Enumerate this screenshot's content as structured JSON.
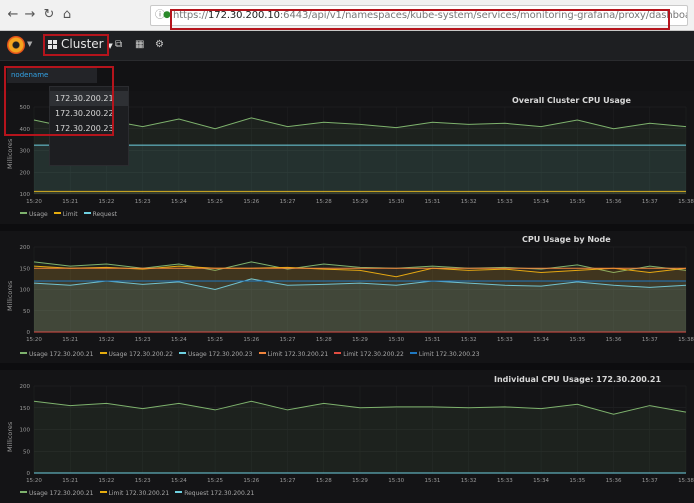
{
  "browser": {
    "url_prefix": "https://",
    "url_host": "172.30.200.10",
    "url_rest": ":6443/api/v1/namespaces/kube-system/services/monitoring-grafana/proxy/dashboard/db/cluster?orgId"
  },
  "navbar": {
    "dashboard_title": "Cluster",
    "highlight_color": "#b5141c"
  },
  "variables": {
    "label": "nodename",
    "options": [
      "172.30.200.21",
      "172.30.200.22",
      "172.30.200.23"
    ],
    "selected_index": 0
  },
  "chart_data": [
    {
      "type": "line",
      "title": "Overall Cluster CPU Usage",
      "ylabel": "Millicores",
      "ylim": [
        100,
        500
      ],
      "yticks": [
        100,
        200,
        300,
        400,
        500
      ],
      "categories": [
        "15:20",
        "15:21",
        "15:22",
        "15:23",
        "15:24",
        "15:25",
        "15:26",
        "15:27",
        "15:28",
        "15:29",
        "15:30",
        "15:31",
        "15:32",
        "15:33",
        "15:34",
        "15:35",
        "15:36",
        "15:37",
        "15:38"
      ],
      "series": [
        {
          "name": "Usage",
          "color": "#7eb26d",
          "values": [
            440,
            405,
            440,
            410,
            445,
            400,
            450,
            410,
            430,
            420,
            405,
            430,
            420,
            425,
            410,
            440,
            400,
            425,
            410
          ]
        },
        {
          "name": "Limit",
          "color": "#e5ac0e",
          "values": [
            112,
            112,
            112,
            112,
            112,
            112,
            112,
            112,
            112,
            112,
            112,
            112,
            112,
            112,
            112,
            112,
            112,
            112,
            112
          ]
        },
        {
          "name": "Request",
          "color": "#6ed0e0",
          "values": [
            325,
            325,
            325,
            325,
            325,
            325,
            325,
            325,
            325,
            325,
            325,
            325,
            325,
            325,
            325,
            325,
            325,
            325,
            325
          ]
        }
      ]
    },
    {
      "type": "line",
      "title": "CPU Usage by Node",
      "ylabel": "Millicores",
      "ylim": [
        0,
        200
      ],
      "yticks": [
        0,
        50,
        100,
        150,
        200
      ],
      "categories": [
        "15:20",
        "15:21",
        "15:22",
        "15:23",
        "15:24",
        "15:25",
        "15:26",
        "15:27",
        "15:28",
        "15:29",
        "15:30",
        "15:31",
        "15:32",
        "15:33",
        "15:34",
        "15:35",
        "15:36",
        "15:37",
        "15:38"
      ],
      "series": [
        {
          "name": "Usage 172.30.200.21",
          "color": "#7eb26d",
          "values": [
            165,
            155,
            160,
            150,
            160,
            145,
            165,
            148,
            160,
            152,
            150,
            155,
            150,
            152,
            148,
            158,
            140,
            155,
            145
          ]
        },
        {
          "name": "Usage 172.30.200.22",
          "color": "#e5ac0e",
          "values": [
            155,
            150,
            152,
            148,
            155,
            150,
            150,
            152,
            148,
            145,
            130,
            150,
            145,
            148,
            140,
            145,
            150,
            140,
            150
          ]
        },
        {
          "name": "Usage 172.30.200.23",
          "color": "#6ed0e0",
          "values": [
            115,
            110,
            120,
            112,
            118,
            100,
            125,
            110,
            112,
            115,
            110,
            120,
            115,
            110,
            108,
            118,
            110,
            105,
            110
          ]
        },
        {
          "name": "Limit 172.30.200.21",
          "color": "#ef843c",
          "values": [
            150,
            150,
            150,
            150,
            150,
            150,
            150,
            150,
            150,
            150,
            150,
            150,
            150,
            150,
            150,
            150,
            150,
            150,
            150
          ]
        },
        {
          "name": "Limit 172.30.200.22",
          "color": "#e24d42",
          "values": [
            0,
            0,
            0,
            0,
            0,
            0,
            0,
            0,
            0,
            0,
            0,
            0,
            0,
            0,
            0,
            0,
            0,
            0,
            0
          ]
        },
        {
          "name": "Limit 172.30.200.23",
          "color": "#1f78c1",
          "values": [
            120,
            120,
            120,
            120,
            120,
            120,
            120,
            120,
            120,
            120,
            120,
            120,
            120,
            120,
            120,
            120,
            120,
            120,
            120
          ]
        }
      ]
    },
    {
      "type": "line",
      "title": "Individual CPU Usage: 172.30.200.21",
      "ylabel": "Millicores",
      "ylim": [
        0,
        200
      ],
      "yticks": [
        0,
        50,
        100,
        150,
        200
      ],
      "categories": [
        "15:20",
        "15:21",
        "15:22",
        "15:23",
        "15:24",
        "15:25",
        "15:26",
        "15:27",
        "15:28",
        "15:29",
        "15:30",
        "15:31",
        "15:32",
        "15:33",
        "15:34",
        "15:35",
        "15:36",
        "15:37",
        "15:38"
      ],
      "series": [
        {
          "name": "Usage 172.30.200.21",
          "color": "#7eb26d",
          "values": [
            165,
            155,
            160,
            148,
            160,
            145,
            165,
            145,
            160,
            150,
            152,
            152,
            150,
            152,
            148,
            158,
            135,
            155,
            140
          ]
        },
        {
          "name": "Limit 172.30.200.21",
          "color": "#e5ac0e",
          "values": [
            0,
            0,
            0,
            0,
            0,
            0,
            0,
            0,
            0,
            0,
            0,
            0,
            0,
            0,
            0,
            0,
            0,
            0,
            0
          ]
        },
        {
          "name": "Request 172.30.200.21",
          "color": "#6ed0e0",
          "values": [
            0,
            0,
            0,
            0,
            0,
            0,
            0,
            0,
            0,
            0,
            0,
            0,
            0,
            0,
            0,
            0,
            0,
            0,
            0
          ]
        }
      ]
    }
  ]
}
